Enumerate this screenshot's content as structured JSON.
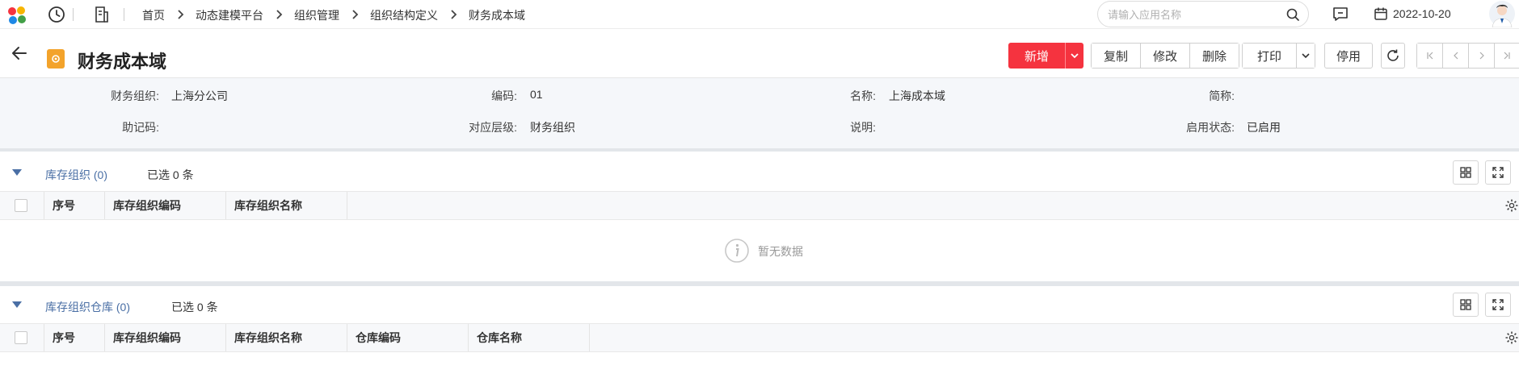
{
  "topbar": {
    "breadcrumbs": [
      "首页",
      "动态建模平台",
      "组织管理",
      "组织结构定义",
      "财务成本域"
    ],
    "search_placeholder": "请输入应用名称",
    "date": "2022-10-20",
    "icons": [
      "app-logo",
      "history-icon",
      "document-icon",
      "search-icon",
      "message-icon",
      "calendar-icon",
      "avatar"
    ]
  },
  "header": {
    "title": "财务成本域",
    "buttons": {
      "new": "新增",
      "copy": "复制",
      "edit": "修改",
      "delete": "删除",
      "print": "打印",
      "disable": "停用"
    }
  },
  "info": {
    "fields": [
      {
        "label": "财务组织:",
        "value": "上海分公司"
      },
      {
        "label": "编码:",
        "value": "01"
      },
      {
        "label": "名称:",
        "value": "上海成本域"
      },
      {
        "label": "简称:",
        "value": ""
      },
      {
        "label": "助记码:",
        "value": ""
      },
      {
        "label": "对应层级:",
        "value": "财务组织"
      },
      {
        "label": "说明:",
        "value": ""
      },
      {
        "label": "启用状态:",
        "value": "已启用"
      }
    ]
  },
  "section1": {
    "title": "库存组织 (0)",
    "selected": "已选 0 条",
    "columns": [
      "序号",
      "库存组织编码",
      "库存组织名称"
    ],
    "empty_text": "暂无数据"
  },
  "section2": {
    "title": "库存组织仓库 (0)",
    "selected": "已选 0 条",
    "columns": [
      "序号",
      "库存组织编码",
      "库存组织名称",
      "仓库编码",
      "仓库名称"
    ]
  },
  "colors": {
    "accent_red": "#f5333f",
    "section_title": "#4a6fa5",
    "info_bg": "#f5f7fa"
  }
}
